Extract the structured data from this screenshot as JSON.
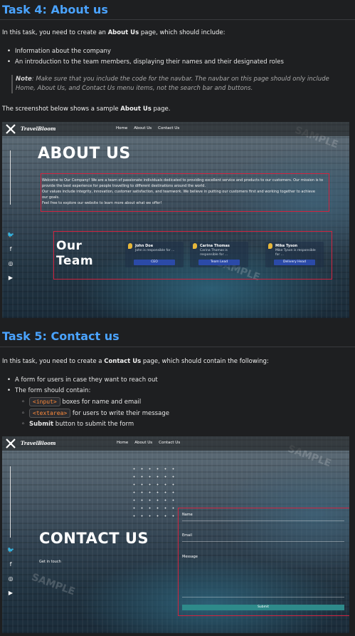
{
  "task4": {
    "title": "Task 4: About us",
    "intro_pre": "In this task, you need to create an ",
    "intro_bold": "About Us",
    "intro_post": " page, which should include:",
    "bullets": [
      "Information about the company",
      "An introduction to the team members, displaying their names and their designated roles"
    ],
    "note_label": "Note",
    "note_text": ": Make sure that you include the code for the navbar. The navbar on this page should only include Home, About Us, and Contact Us menu items, not the search bar and buttons.",
    "shot_caption_pre": "The screenshot below shows a sample ",
    "shot_caption_bold": "About Us",
    "shot_caption_post": " page."
  },
  "about_shot": {
    "brand": "TravelBloom",
    "nav": [
      "Home",
      "About Us",
      "Contact Us"
    ],
    "heading": "ABOUT US",
    "intro_lines": [
      "Welcome to Our Company! We are a team of passionate individuals dedicated to providing excellent service and products to our customers. Our mission is to",
      "provide the best experience for people travelling to different destinations around the world.",
      "Our values include integrity, innovation, customer satisfaction, and teamwork. We believe in putting our customers first and working together to achieve",
      "our goals.",
      "Feel free to explore our website to learn more about what we offer!"
    ],
    "team_heading_1": "Our",
    "team_heading_2": "Team",
    "cards": [
      {
        "name": "John Doe",
        "desc": "John is responsible for ...",
        "role": "CEO"
      },
      {
        "name": "Carina Thomas",
        "desc": "Carina Thomas is responsible for ...",
        "role": "Team Lead"
      },
      {
        "name": "Mike Tyson",
        "desc": "Mike Tyson is responsible for ...",
        "role": "Delivery Head"
      }
    ],
    "watermark": "SAMPLE"
  },
  "task5": {
    "title": "Task 5: Contact us",
    "intro_pre": "In this task, you need to create a ",
    "intro_bold": "Contact Us",
    "intro_post": " page, which should contain the following:",
    "bullet1": "A form for users in case they want to reach out",
    "bullet2": "The form should contain:",
    "sub1_code": "<input>",
    "sub1_text": " boxes for name and email",
    "sub2_code": "<textarea>",
    "sub2_text": " for users to write their message",
    "sub3_bold": "Submit",
    "sub3_text": " button to submit the form"
  },
  "contact_shot": {
    "brand": "TravelBloom",
    "nav": [
      "Home",
      "About Us",
      "Contact Us"
    ],
    "heading": "CONTACT US",
    "subheading": "Get in touch",
    "labels": [
      "Name",
      "Email",
      "Message"
    ],
    "submit": "Submit",
    "watermark": "SAMPLE"
  }
}
